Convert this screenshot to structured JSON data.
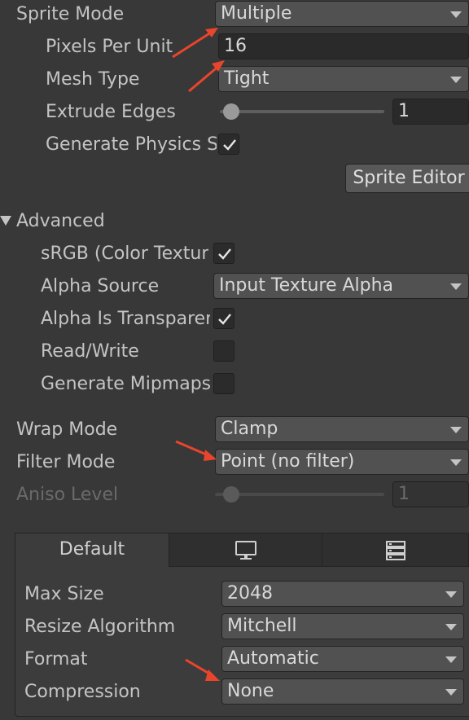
{
  "sprite_mode": {
    "label": "Sprite Mode",
    "value": "Multiple"
  },
  "pixels_per_unit": {
    "label": "Pixels Per Unit",
    "value": "16"
  },
  "mesh_type": {
    "label": "Mesh Type",
    "value": "Tight"
  },
  "extrude_edges": {
    "label": "Extrude Edges",
    "value": "1"
  },
  "generate_physics": {
    "label": "Generate Physics Shape",
    "checked": true
  },
  "sprite_editor_button": "Sprite Editor",
  "advanced": {
    "label": "Advanced",
    "srgb": {
      "label": "sRGB (Color Texture)",
      "checked": true
    },
    "alpha_source": {
      "label": "Alpha Source",
      "value": "Input Texture Alpha"
    },
    "alpha_is_transparency": {
      "label": "Alpha Is Transparency",
      "checked": true
    },
    "read_write": {
      "label": "Read/Write",
      "checked": false
    },
    "generate_mipmaps": {
      "label": "Generate Mipmaps",
      "checked": false
    }
  },
  "wrap_mode": {
    "label": "Wrap Mode",
    "value": "Clamp"
  },
  "filter_mode": {
    "label": "Filter Mode",
    "value": "Point (no filter)"
  },
  "aniso_level": {
    "label": "Aniso Level",
    "value": "1"
  },
  "platform_tabs": {
    "default_label": "Default",
    "icons": [
      "monitor-icon",
      "server-icon"
    ]
  },
  "platform_settings": {
    "max_size": {
      "label": "Max Size",
      "value": "2048"
    },
    "resize_algorithm": {
      "label": "Resize Algorithm",
      "value": "Mitchell"
    },
    "format": {
      "label": "Format",
      "value": "Automatic"
    },
    "compression": {
      "label": "Compression",
      "value": "None"
    }
  },
  "colors": {
    "annotation_arrow": "#e8452c",
    "background": "#383838"
  }
}
